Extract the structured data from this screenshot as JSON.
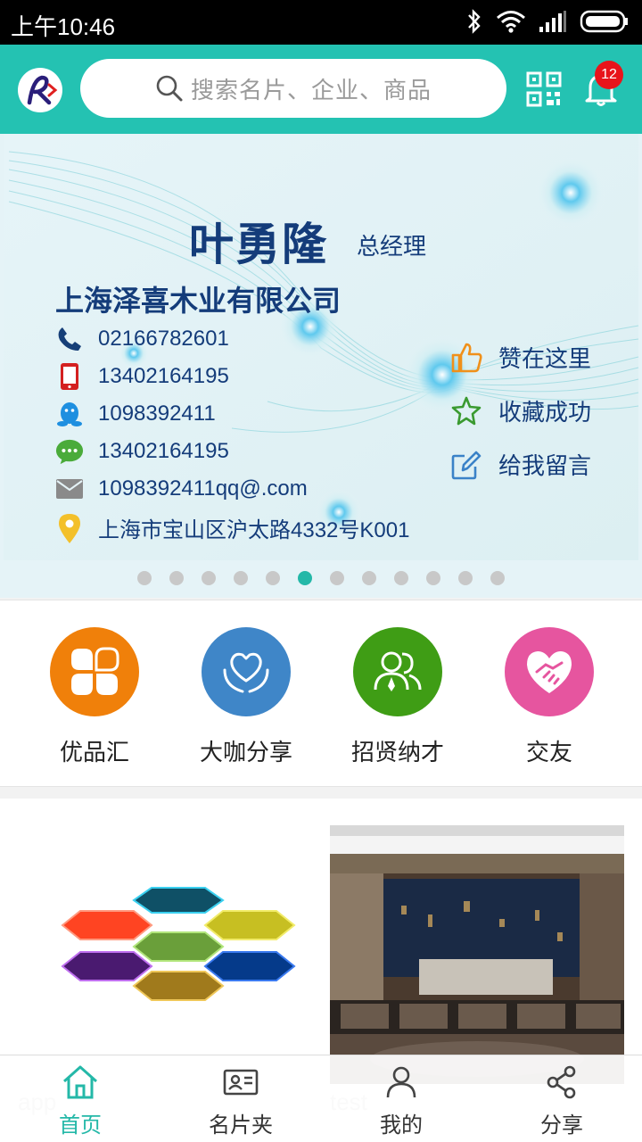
{
  "status_bar": {
    "time": "上午10:46"
  },
  "header": {
    "search_placeholder": "搜索名片、企业、商品",
    "notification_count": "12"
  },
  "card": {
    "name": "叶勇隆",
    "title": "总经理",
    "company": "上海泽喜木业有限公司",
    "contacts": [
      {
        "icon": "phone-icon",
        "value": "02166782601"
      },
      {
        "icon": "mobile-icon",
        "value": "13402164195"
      },
      {
        "icon": "qq-icon",
        "value": "1098392411"
      },
      {
        "icon": "wechat-icon",
        "value": "13402164195"
      },
      {
        "icon": "mail-icon",
        "value": "1098392411qq@.com"
      },
      {
        "icon": "location-icon",
        "value": "上海市宝山区沪太路4332号K001"
      }
    ],
    "actions": [
      {
        "icon": "thumbs-up-icon",
        "label": "赞在这里"
      },
      {
        "icon": "star-icon",
        "label": "收藏成功"
      },
      {
        "icon": "edit-icon",
        "label": "给我留言"
      }
    ],
    "page_count": 12,
    "active_page": 6
  },
  "quick_menu": [
    {
      "label": "优品汇",
      "color": "#f0800a"
    },
    {
      "label": "大咖分享",
      "color": "#3f86c8"
    },
    {
      "label": "招贤纳才",
      "color": "#3f9d15"
    },
    {
      "label": "交友",
      "color": "#e6559f"
    }
  ],
  "products": {
    "left_label": "app",
    "right_label": "test"
  },
  "bottom_nav": [
    {
      "label": "首页",
      "active": true
    },
    {
      "label": "名片夹",
      "active": false
    },
    {
      "label": "我的",
      "active": false
    },
    {
      "label": "分享",
      "active": false
    }
  ],
  "colors": {
    "brand": "#24c2b2",
    "text_dark": "#143c7a",
    "badge": "#e8141b"
  }
}
